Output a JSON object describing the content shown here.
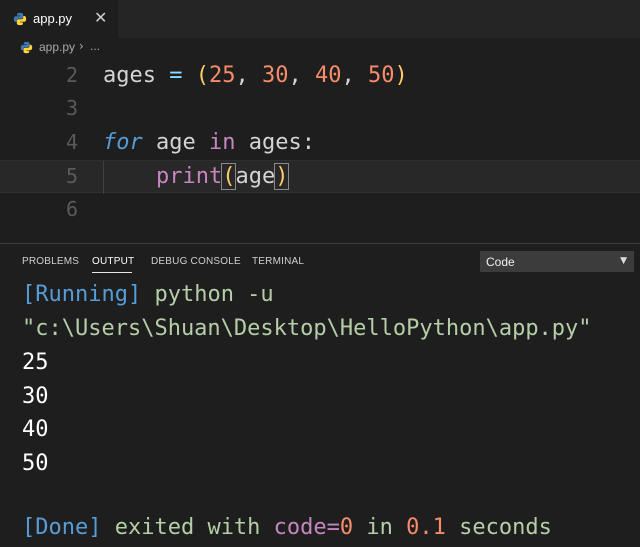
{
  "tab": {
    "label": "app.py",
    "close": "✕"
  },
  "breadcrumb": {
    "file": "app.py",
    "separator": "›",
    "more": "..."
  },
  "editor": {
    "lines": [
      {
        "number": "2",
        "tokens": [
          "ages",
          " = ",
          "(",
          "25",
          ", ",
          "30",
          ", ",
          "40",
          ", ",
          "50",
          ")"
        ]
      },
      {
        "number": "3",
        "tokens": []
      },
      {
        "number": "4",
        "tokens": [
          "for",
          " age ",
          "in",
          " ages:"
        ]
      },
      {
        "number": "5",
        "tokens": [
          "    ",
          "print",
          "(",
          "age",
          ")"
        ]
      },
      {
        "number": "6",
        "tokens": []
      }
    ]
  },
  "panel": {
    "tabs": [
      "PROBLEMS",
      "OUTPUT",
      "DEBUG CONSOLE",
      "TERMINAL"
    ],
    "active_tab": "OUTPUT",
    "channel_select": "Code",
    "output": {
      "running_tag": "[Running]",
      "command": " python -u",
      "path": "\"c:\\Users\\Shuan\\Desktop\\HelloPython\\app.py\"",
      "results": [
        "25",
        "30",
        "40",
        "50"
      ],
      "done_tag": "[Done]",
      "exited": " exited with ",
      "code_label": "code=",
      "code_value": "0",
      "in_label": " in ",
      "time_value": "0.1",
      "seconds": " seconds"
    }
  },
  "colors": {
    "background": "#1e1e1e",
    "keyword": "#569cd6",
    "function": "#c586c0",
    "number": "#f78c6c",
    "paren": "#ffcb6b"
  },
  "icons": {
    "file_icon": "python-icon",
    "dropdown": "chevron-down-icon"
  }
}
